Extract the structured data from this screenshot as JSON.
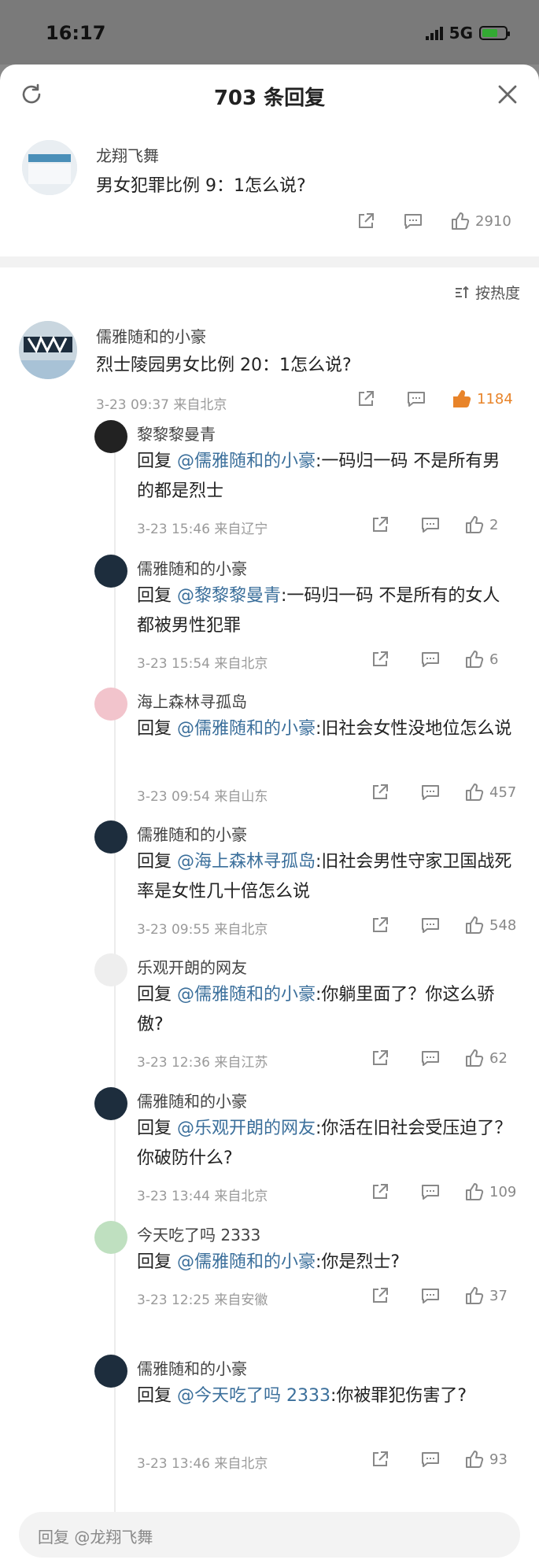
{
  "status": {
    "time": "16:17",
    "network": "5G"
  },
  "header": {
    "title": "703 条回复"
  },
  "root": {
    "name": "龙翔飞舞",
    "text": "男女犯罪比例 9：1怎么说?",
    "likes": "2910"
  },
  "sort": {
    "label": "按热度"
  },
  "comment": {
    "name": "儒雅随和的小豪",
    "text": "烈士陵园男女比例 20：1怎么说?",
    "meta": "3-23 09:37  来自北京",
    "likes": "1184"
  },
  "replies": [
    {
      "name": "黎黎黎曼青",
      "prefix": "回复 ",
      "mention": "@儒雅随和的小豪",
      "body": ":一码归一码 不是所有男的都是烈士",
      "meta": "3-23 15:46  来自辽宁",
      "likes": "2"
    },
    {
      "name": "儒雅随和的小豪",
      "prefix": "回复 ",
      "mention": "@黎黎黎曼青",
      "body": ":一码归一码 不是所有的女人都被男性犯罪",
      "meta": "3-23 15:54  来自北京",
      "likes": "6"
    },
    {
      "name": "海上森林寻孤岛",
      "prefix": "回复 ",
      "mention": "@儒雅随和的小豪",
      "body": ":旧社会女性没地位怎么说",
      "meta": "3-23 09:54  来自山东",
      "likes": "457"
    },
    {
      "name": "儒雅随和的小豪",
      "prefix": "回复 ",
      "mention": "@海上森林寻孤岛",
      "body": ":旧社会男性守家卫国战死率是女性几十倍怎么说",
      "meta": "3-23 09:55  来自北京",
      "likes": "548"
    },
    {
      "name": "乐观开朗的网友",
      "prefix": "回复 ",
      "mention": "@儒雅随和的小豪",
      "body": ":你躺里面了？你这么骄傲?",
      "meta": "3-23 12:36  来自江苏",
      "likes": "62"
    },
    {
      "name": "儒雅随和的小豪",
      "prefix": "回复 ",
      "mention": "@乐观开朗的网友",
      "body": ":你活在旧社会受压迫了？你破防什么?",
      "meta": "3-23 13:44  来自北京",
      "likes": "109"
    },
    {
      "name": "今天吃了吗 2333",
      "prefix": "回复 ",
      "mention": "@儒雅随和的小豪",
      "body": ":你是烈士?",
      "meta": "3-23 12:25  来自安徽",
      "likes": "37"
    },
    {
      "name": "儒雅随和的小豪",
      "prefix": "回复 ",
      "mention": "@今天吃了吗 2333",
      "body": ":你被罪犯伤害了?",
      "meta": "3-23 13:46  来自北京",
      "likes": "93"
    }
  ],
  "input": {
    "placeholder": "回复 @龙翔飞舞"
  },
  "colors": {
    "accent_like": "#e8842a",
    "mention": "#3b6f9b"
  }
}
